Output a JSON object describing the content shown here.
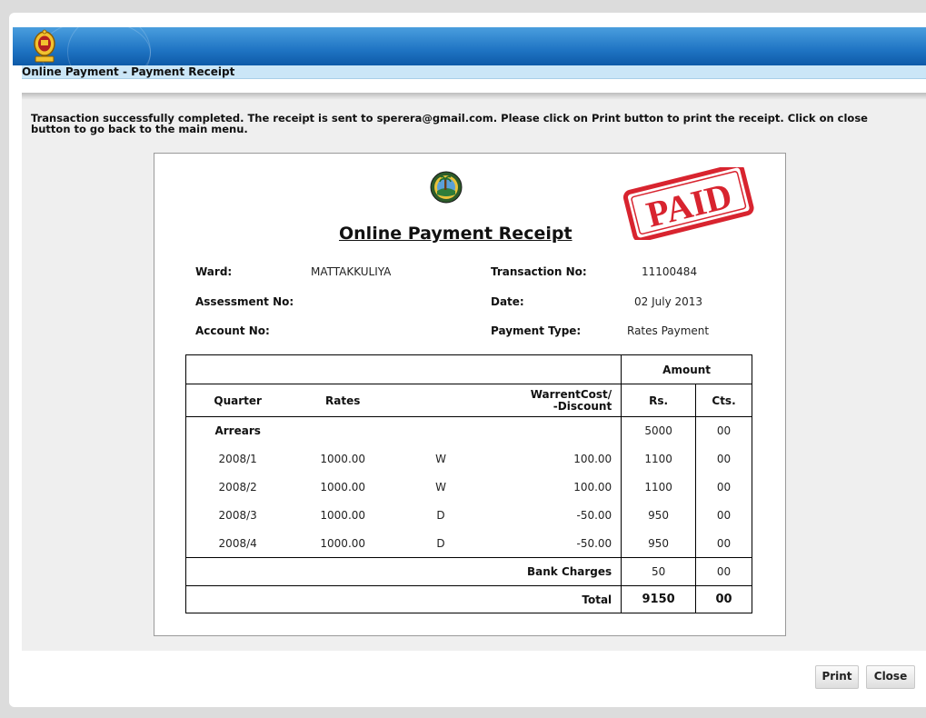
{
  "header": {
    "title": "Online Payment - Payment Receipt"
  },
  "message": "Transaction successfully completed. The receipt is sent to sperera@gmail.com. Please click on Print button to print the receipt. Click on close button to go back to the main menu.",
  "receipt": {
    "title": "Online Payment Receipt",
    "stamp_text": "PAID",
    "fields": {
      "ward_label": "Ward:",
      "ward_value": "MATTAKKULIYA",
      "transaction_label": "Transaction No:",
      "transaction_value": "11100484",
      "assessment_label": "Assessment No:",
      "assessment_value": "",
      "date_label": "Date:",
      "date_value": "02 July 2013",
      "account_label": "Account No:",
      "account_value": "",
      "payment_type_label": "Payment Type:",
      "payment_type_value": "Rates Payment"
    },
    "table": {
      "amount_header": "Amount",
      "col_quarter": "Quarter",
      "col_rates": "Rates",
      "col_warrent_line1": "WarrentCost/",
      "col_warrent_line2": "-Discount",
      "col_rs": "Rs.",
      "col_cts": "Cts.",
      "arrears": {
        "label": "Arrears",
        "rs": "5000",
        "cts": "00"
      },
      "rows": [
        {
          "quarter": "2008/1",
          "rates": "1000.00",
          "code": "W",
          "cost": "100.00",
          "rs": "1100",
          "cts": "00"
        },
        {
          "quarter": "2008/2",
          "rates": "1000.00",
          "code": "W",
          "cost": "100.00",
          "rs": "1100",
          "cts": "00"
        },
        {
          "quarter": "2008/3",
          "rates": "1000.00",
          "code": "D",
          "cost": "-50.00",
          "rs": "950",
          "cts": "00"
        },
        {
          "quarter": "2008/4",
          "rates": "1000.00",
          "code": "D",
          "cost": "-50.00",
          "rs": "950",
          "cts": "00"
        }
      ],
      "bank_charges": {
        "label": "Bank Charges",
        "rs": "50",
        "cts": "00"
      },
      "total": {
        "label": "Total",
        "rs": "9150",
        "cts": "00"
      }
    }
  },
  "buttons": {
    "print": "Print",
    "close": "Close"
  },
  "colors": {
    "banner": "#1f74c3",
    "title_bar": "#cbe6f7",
    "stamp": "#d8242f"
  }
}
